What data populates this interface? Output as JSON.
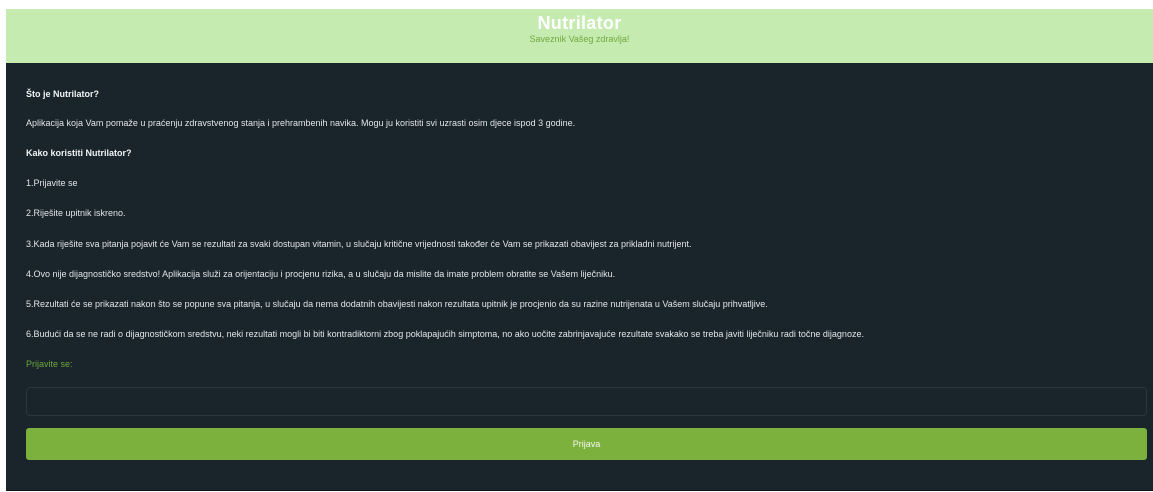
{
  "header": {
    "title": "Nutrilator",
    "subtitle": "Saveznik Vašeg zdravlja!"
  },
  "info": {
    "heading_what": "Što je Nutrilator?",
    "description": "Aplikacija koja Vam pomaže u praćenju zdravstvenog stanja i prehrambenih navika. Mogu ju koristiti svi uzrasti osim djece ispod 3 godine.",
    "heading_how": "Kako koristiti Nutrilator?",
    "steps": [
      "1.Prijavite se",
      "2.Riješite upitnik iskreno.",
      "3.Kada riješite sva pitanja pojavit će Vam se rezultati za svaki dostupan vitamin, u slučaju kritične vrijednosti također će Vam se prikazati obavijest za prikladni nutrijent.",
      "4.Ovo nije dijagnostičko sredstvo! Aplikacija služi za orijentaciju i procjenu rizika, a u slučaju da mislite da imate problem obratite se Vašem liječniku.",
      "5.Rezultati će se prikazati nakon što se popune sva pitanja, u slučaju da nema dodatnih obavijesti nakon rezultata upitnik je procjenio da su razine nutrijenata u Vašem slučaju prihvatljive.",
      "6.Budući da se ne radi o dijagnostičkom sredstvu, neki rezultati mogli bi biti kontradiktorni zbog poklapajućih simptoma, no ako uočite zabrinjavajuće rezultate svakako se treba javiti liječniku radi točne dijagnoze."
    ]
  },
  "login": {
    "label": "Prijavite se:",
    "input_value": "",
    "input_placeholder": "",
    "button_label": "Prijava"
  },
  "colors": {
    "header_bg": "#c6ebb0",
    "main_bg": "#1a242b",
    "accent_green": "#7db13e",
    "label_green": "#6fa83e"
  }
}
